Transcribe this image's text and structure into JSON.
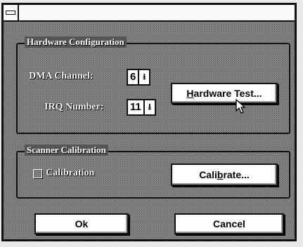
{
  "dialog": {
    "hardware_group": {
      "title": "Hardware Configuration",
      "dma_label": "DMA Channel:",
      "dma_value": "6",
      "irq_label": "IRQ Number:",
      "irq_value": "11",
      "hardware_test_button": {
        "before": "",
        "mnemonic": "H",
        "after": "ardware Test..."
      }
    },
    "calibration_group": {
      "title": "Scanner Calibration",
      "checkbox_label": "Calibration",
      "checkbox_checked": false,
      "calibrate_button": {
        "before": "Cali",
        "mnemonic": "b",
        "after": "rate..."
      }
    },
    "ok_label": "Ok",
    "cancel_label": "Cancel"
  },
  "icons": {
    "system_menu": "system-menu-icon",
    "spin_arrow": "spin-down-arrow-icon",
    "cursor": "mouse-pointer-icon"
  }
}
